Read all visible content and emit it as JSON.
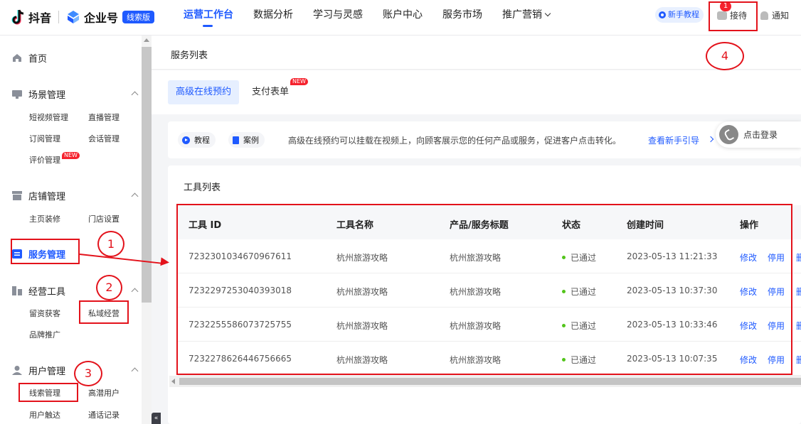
{
  "header": {
    "douyin_label": "抖音",
    "enterprise_label": "企业号",
    "edition_badge": "线索版",
    "nav": [
      {
        "label": "运营工作台",
        "active": true
      },
      {
        "label": "数据分析"
      },
      {
        "label": "学习与灵感"
      },
      {
        "label": "账户中心"
      },
      {
        "label": "服务市场"
      },
      {
        "label": "推广营销"
      }
    ],
    "guide_label": "新手教程",
    "reception_label": "接待",
    "reception_count": "1",
    "notify_label": "通知"
  },
  "sidebar": {
    "home": "首页",
    "groups": {
      "scene": {
        "label": "场景管理",
        "items": [
          "短视频管理",
          "直播管理",
          "订阅管理",
          "会话管理",
          "评价管理"
        ]
      },
      "store": {
        "label": "店铺管理",
        "items": [
          "主页装修",
          "门店设置"
        ]
      },
      "service": {
        "label": "服务管理"
      },
      "ops": {
        "label": "经营工具",
        "items": [
          "留资获客",
          "私域经营",
          "品牌推广"
        ]
      },
      "user": {
        "label": "用户管理",
        "items": [
          "线索管理",
          "高潜用户",
          "用户触达",
          "通话记录"
        ]
      }
    },
    "new_tag": "NEW",
    "collapse_icon": "«"
  },
  "page": {
    "title": "服务列表",
    "tabs": [
      "高级在线预约",
      "支付表单"
    ],
    "tab_new_tag": "NEW",
    "tutorial_label": "教程",
    "case_label": "案例",
    "description": "高级在线预约可以挂载在视频上，向顾客展示您的任何产品或服务，促进客户点击转化。",
    "guide_link": "查看新手引导",
    "login_label": "点击登录"
  },
  "tools": {
    "title": "工具列表",
    "columns": [
      "工具 ID",
      "工具名称",
      "产品/服务标题",
      "状态",
      "创建时间",
      "操作"
    ],
    "rows": [
      {
        "id": "7232301034670967611",
        "name": "杭州旅游攻略",
        "title": "杭州旅游攻略",
        "status": "已通过",
        "created": "2023-05-13 11:21:33"
      },
      {
        "id": "7232297253040393018",
        "name": "杭州旅游攻略",
        "title": "杭州旅游攻略",
        "status": "已通过",
        "created": "2023-05-13 10:37:30"
      },
      {
        "id": "7232255586073725755",
        "name": "杭州旅游攻略",
        "title": "杭州旅游攻略",
        "status": "已通过",
        "created": "2023-05-13 10:33:46"
      },
      {
        "id": "7232278626446756665",
        "name": "杭州旅游攻略",
        "title": "杭州旅游攻略",
        "status": "已通过",
        "created": "2023-05-13 10:07:35"
      }
    ],
    "action_edit": "修改",
    "action_disable": "停用",
    "action_delete_cut": "删"
  },
  "annotations": [
    "1",
    "2",
    "3",
    "4"
  ],
  "colors": {
    "accent": "#1f5aff",
    "annotation": "#e3121b",
    "status_ok": "#52c41a",
    "badge": "#f5222d"
  }
}
